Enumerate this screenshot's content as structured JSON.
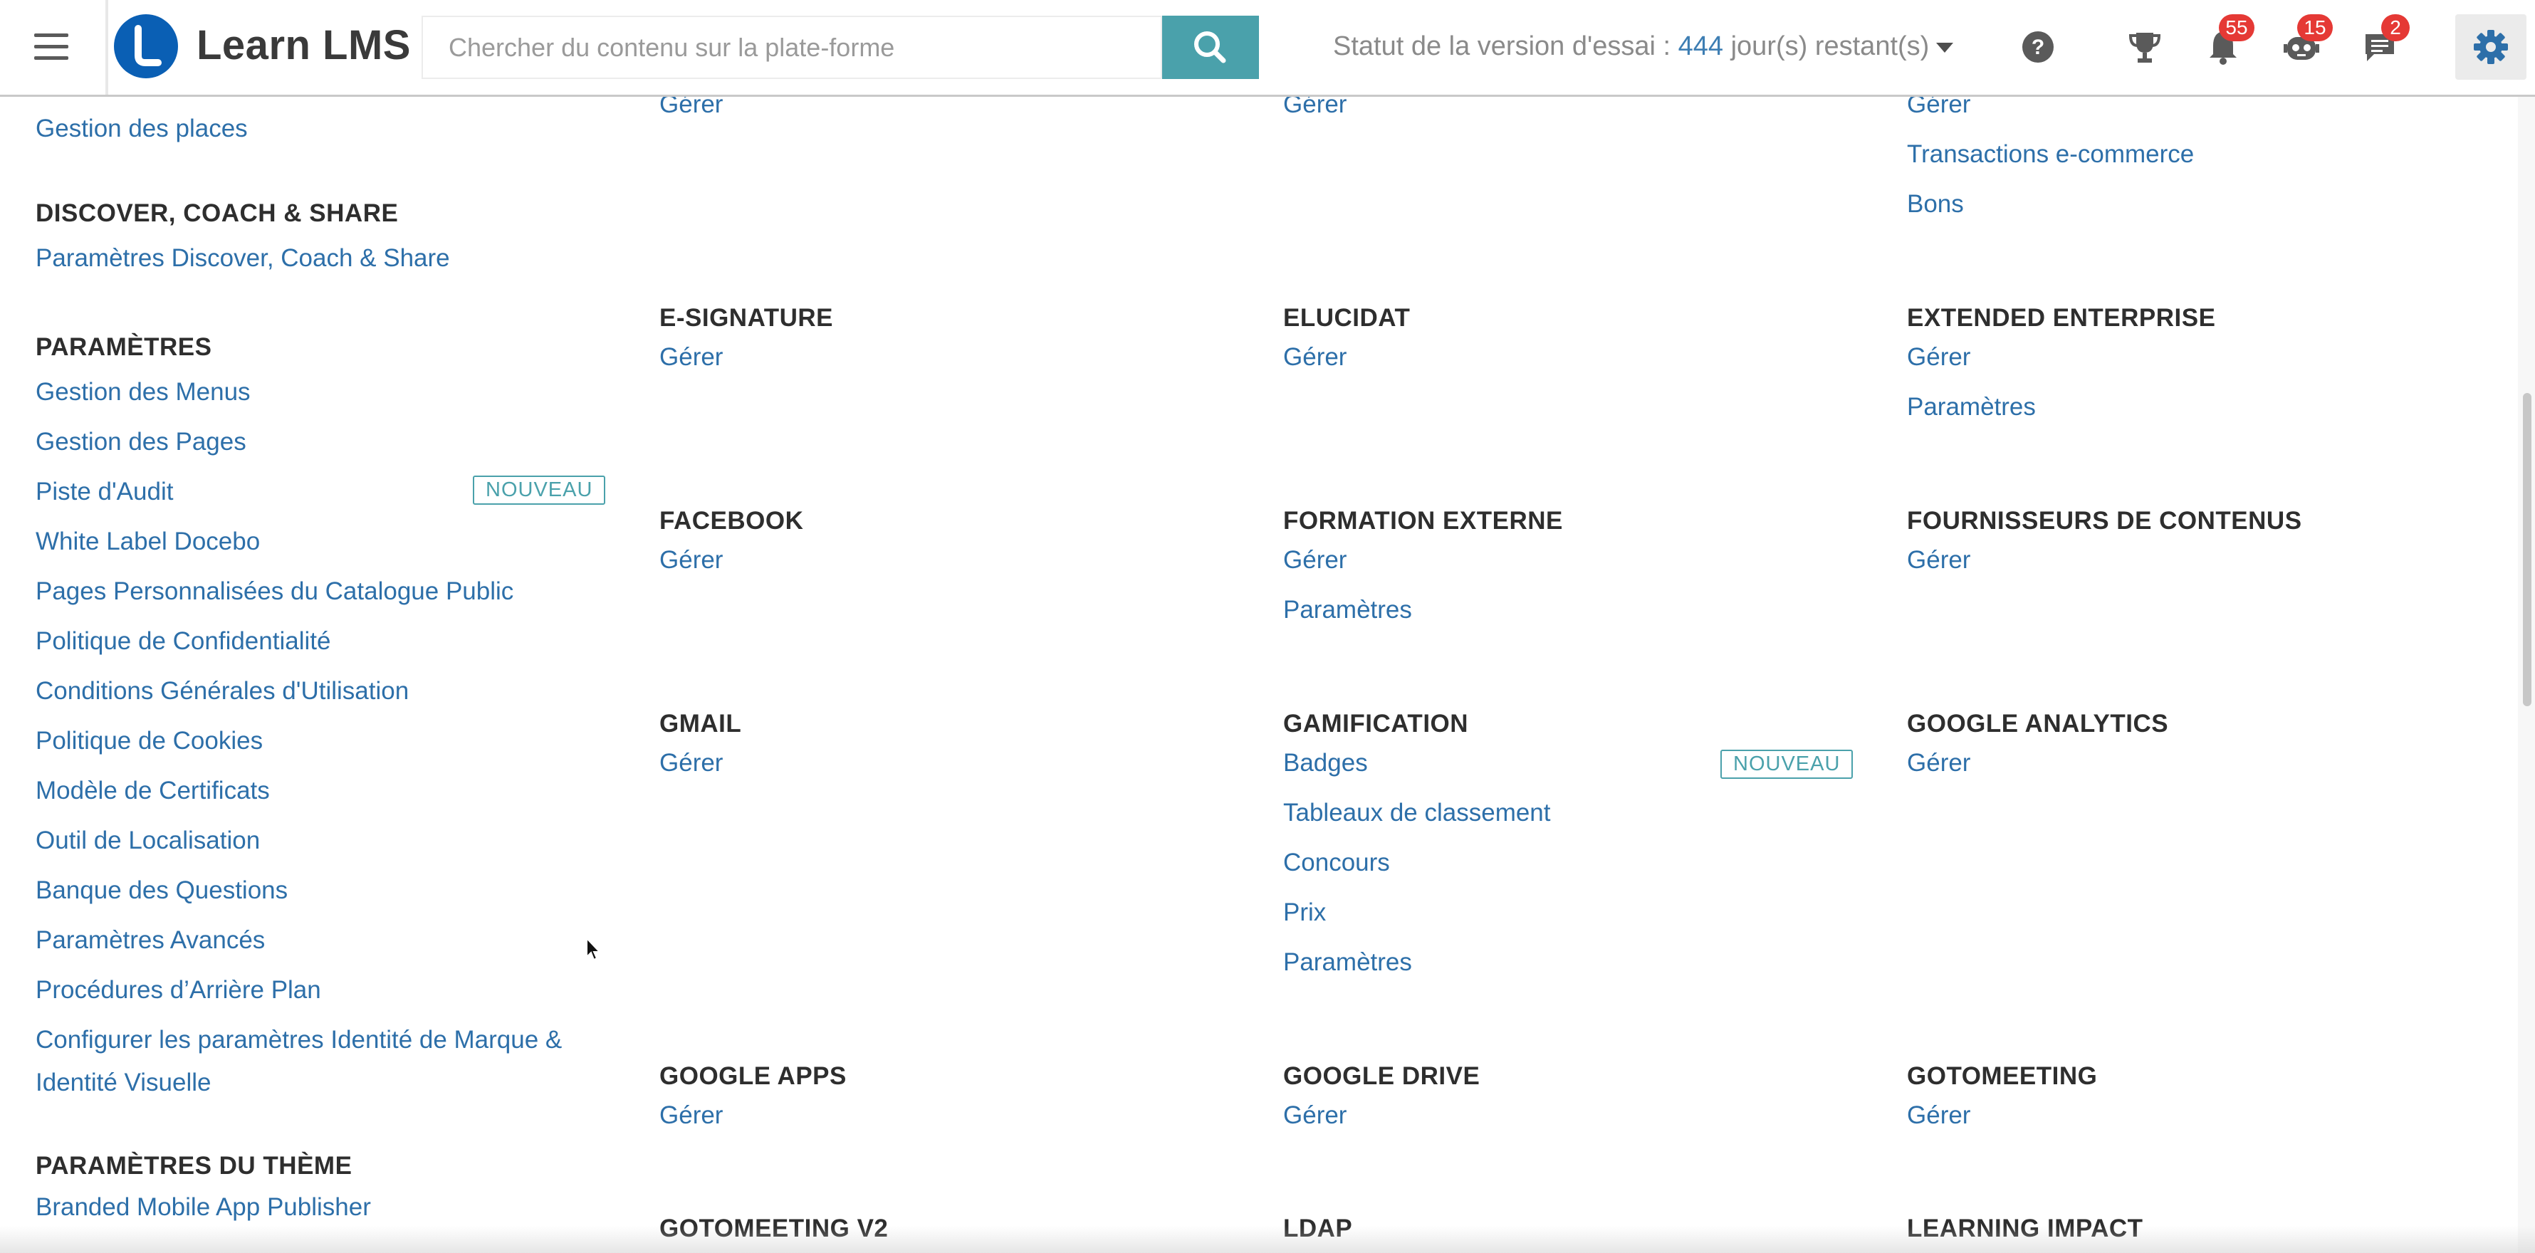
{
  "header": {
    "brand": "Learn LMS",
    "search_placeholder": "Chercher du contenu sur la plate-forme",
    "trial_prefix": "Statut de la version d'essai : ",
    "trial_days": "444",
    "trial_suffix": " jour(s) restant(s)",
    "badges": {
      "notifications": "55",
      "robot": "15",
      "messages": "2"
    },
    "colors": {
      "logo": "#0a5fb4",
      "search_button": "#4aa1ab",
      "badge": "#e53935",
      "link": "#2d6fa9"
    }
  },
  "sidebar": {
    "places": "Gestion des places",
    "dcs_heading": "DISCOVER, COACH & SHARE",
    "dcs_settings": "Paramètres Discover, Coach & Share",
    "settings_heading": "PARAMÈTRES",
    "settings_items": [
      "Gestion des Menus",
      "Gestion des Pages",
      "Piste d'Audit",
      "White Label Docebo",
      "Pages Personnalisées du Catalogue Public",
      "Politique de Confidentialité",
      "Conditions Générales d'Utilisation",
      "Politique de Cookies",
      "Modèle de Certificats",
      "Outil de Localisation",
      "Banque des Questions",
      "Paramètres Avancés",
      "Procédures d’Arrière Plan",
      "Configurer les paramètres Identité de Marque &",
      "Identité Visuelle"
    ],
    "new_tag": "NOUVEAU",
    "theme_heading": "PARAMÈTRES DU THÈME",
    "mobile_publisher": "Branded Mobile App Publisher"
  },
  "apps": {
    "top_row": {
      "col1": [
        "Gérer"
      ],
      "col2": [
        "Gérer"
      ],
      "col3": [
        "Gérer",
        "Transactions e-commerce",
        "Bons"
      ]
    },
    "esignature": {
      "title": "E-SIGNATURE",
      "links": [
        "Gérer"
      ]
    },
    "elucidat": {
      "title": "ELUCIDAT",
      "links": [
        "Gérer"
      ]
    },
    "extended_enterprise": {
      "title": "EXTENDED ENTERPRISE",
      "links": [
        "Gérer",
        "Paramètres"
      ]
    },
    "facebook": {
      "title": "FACEBOOK",
      "links": [
        "Gérer"
      ]
    },
    "formation_externe": {
      "title": "FORMATION EXTERNE",
      "links": [
        "Gérer",
        "Paramètres"
      ]
    },
    "fournisseurs": {
      "title": "FOURNISSEURS DE CONTENUS",
      "links": [
        "Gérer"
      ]
    },
    "gmail": {
      "title": "GMAIL",
      "links": [
        "Gérer"
      ]
    },
    "gamification": {
      "title": "GAMIFICATION",
      "links": [
        "Badges",
        "Tableaux de classement",
        "Concours",
        "Prix",
        "Paramètres"
      ],
      "new_tag": "NOUVEAU"
    },
    "google_analytics": {
      "title": "GOOGLE ANALYTICS",
      "links": [
        "Gérer"
      ]
    },
    "google_apps": {
      "title": "GOOGLE APPS",
      "links": [
        "Gérer"
      ]
    },
    "google_drive": {
      "title": "GOOGLE DRIVE",
      "links": [
        "Gérer"
      ]
    },
    "gotomeeting": {
      "title": "GOTOMEETING",
      "links": [
        "Gérer"
      ]
    },
    "gotomeeting_v2": {
      "title": "GOTOMEETING V2"
    },
    "ldap": {
      "title": "LDAP"
    },
    "learning_impact": {
      "title": "LEARNING IMPACT"
    }
  }
}
